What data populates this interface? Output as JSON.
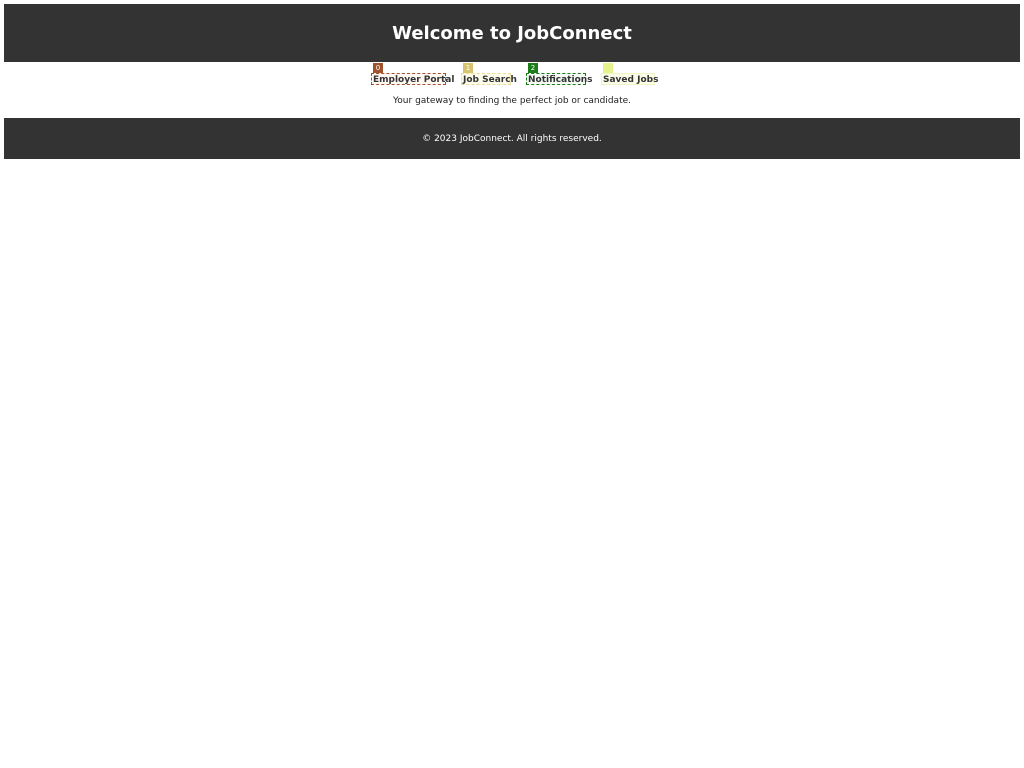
{
  "header": {
    "title": "Welcome to JobConnect"
  },
  "nav": {
    "items": [
      {
        "label": "Employer Portal",
        "badge": "0",
        "badge_color": "#a0522d",
        "border_color": "#a0522d",
        "border_style": "dashed",
        "background": "#fff7f2"
      },
      {
        "label": "Job Search",
        "badge": "1",
        "badge_color": "#d6c46e",
        "border_color": "#e8dc9c",
        "border_style": "dashed",
        "background": "#fdfbea"
      },
      {
        "label": "Notifications",
        "badge": "2",
        "badge_color": "#1a7d1a",
        "border_color": "#1a7d1a",
        "border_style": "dashed",
        "background": "#f3faf3"
      },
      {
        "label": "Saved Jobs",
        "badge": "",
        "badge_color": "#e6f28a",
        "border_color": "#f0f5c8",
        "border_style": "solid",
        "background": "#fbfde9"
      }
    ]
  },
  "tagline": "Your gateway to finding the perfect job or candidate.",
  "footer": {
    "text": "© 2023 JobConnect. All rights reserved."
  }
}
